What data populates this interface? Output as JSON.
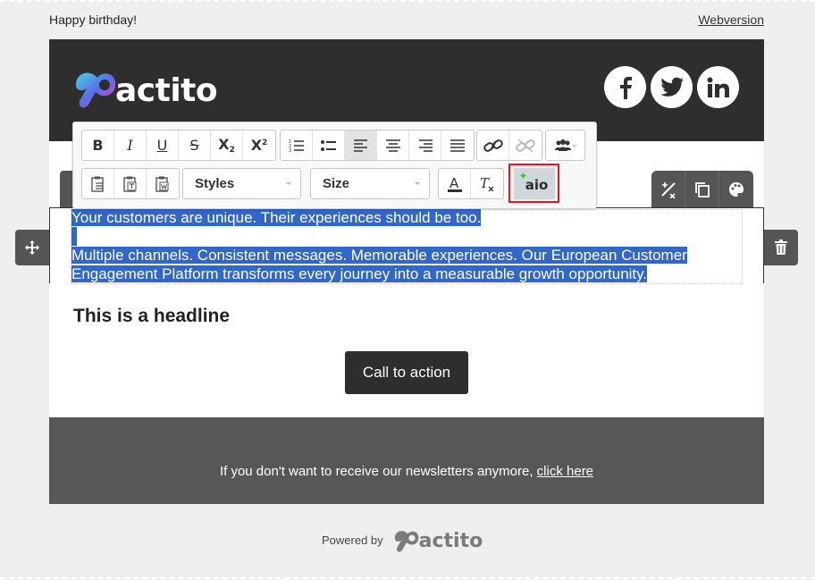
{
  "preheader": {
    "greeting": "Happy birthday!",
    "webversion_link": "Webversion"
  },
  "header": {
    "logo_text": "actito",
    "socials": [
      {
        "icon": "facebook-icon",
        "glyph": "f"
      },
      {
        "icon": "twitter-icon",
        "glyph": "bird"
      },
      {
        "icon": "linkedin-icon",
        "glyph": "in"
      }
    ]
  },
  "toolbar": {
    "row1": [
      {
        "name": "bold-button",
        "icon": "bold-icon",
        "glyph": "B"
      },
      {
        "name": "italic-button",
        "icon": "italic-icon",
        "glyph": "I"
      },
      {
        "name": "underline-button",
        "icon": "underline-icon",
        "glyph": "U"
      },
      {
        "name": "strikethrough-button",
        "icon": "strikethrough-icon",
        "glyph": "S"
      },
      {
        "name": "subscript-button",
        "icon": "subscript-icon",
        "glyph": "X"
      },
      {
        "name": "superscript-button",
        "icon": "superscript-icon",
        "glyph": "X"
      }
    ],
    "styles_label": "Styles",
    "size_label": "Size",
    "aio_label": "aio",
    "colors": {
      "accent_highlight": "#e0191e",
      "selection": "#3067c9"
    }
  },
  "content": {
    "paragraph1": "Your customers are unique. Their experiences should be too.",
    "paragraph2_line1": "Multiple channels. Consistent messages. Memorable experiences. Our European Customer",
    "paragraph2_line2": "Engagement Platform transforms every journey into a measurable growth opportunity.",
    "headline": "This is a headline",
    "cta_label": "Call to action"
  },
  "footer": {
    "unsubscribe_text": "If you don't want to receive our newsletters anymore, ",
    "unsubscribe_link": "click here"
  },
  "powered_by": {
    "label": "Powered by",
    "logo_text": "actito"
  }
}
